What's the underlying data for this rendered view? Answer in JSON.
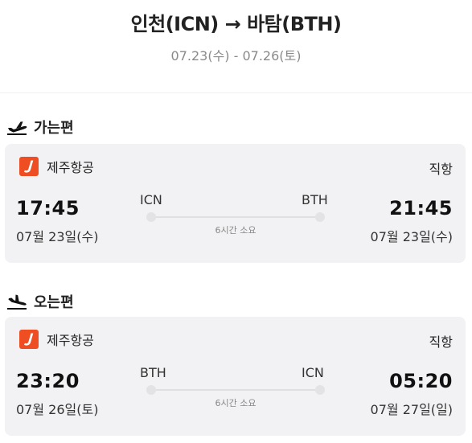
{
  "header": {
    "route": "인천(ICN) → 바탐(BTH)",
    "dates": "07.23(수) - 07.26(토)"
  },
  "outbound": {
    "section_label": "가는편",
    "icon": "plane-takeoff-icon",
    "airline": "제주항공",
    "flight_type": "직항",
    "dep_time": "17:45",
    "dep_date": "07월 23일(수)",
    "dep_code": "ICN",
    "arr_time": "21:45",
    "arr_date": "07월 23일(수)",
    "arr_code": "BTH",
    "duration": "6시간 소요"
  },
  "inbound": {
    "section_label": "오는편",
    "icon": "plane-landing-icon",
    "airline": "제주항공",
    "flight_type": "직항",
    "dep_time": "23:20",
    "dep_date": "07월 26일(토)",
    "dep_code": "BTH",
    "arr_time": "05:20",
    "arr_date": "07월 27일(일)",
    "arr_code": "ICN",
    "duration": "6시간 소요"
  },
  "colors": {
    "brand": "#ef4e23",
    "card_bg": "#f2f2f4",
    "muted_text": "#8a8a8a"
  }
}
